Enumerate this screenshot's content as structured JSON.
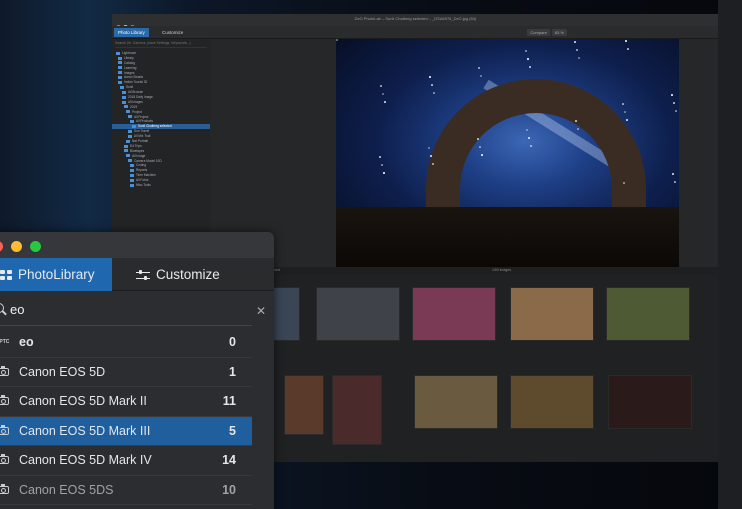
{
  "colors": {
    "accent": "#1f68b0",
    "selected_row": "#1f5f9e",
    "panel_bg": "#2c2d30",
    "traffic_close": "#ff5f57",
    "traffic_min": "#febc2e",
    "traffic_max": "#28c840"
  },
  "background_window": {
    "title": "DxO PhotoLab – Sunil Chalberg selected – _DSA6976_DxO.jpg (84)",
    "tabs": [
      {
        "label": "Photo Library",
        "active": true
      },
      {
        "label": "Customize",
        "active": false
      }
    ],
    "toolbar": {
      "compare": "Compare",
      "zoom": "83 %"
    },
    "sidebar_search_placeholder": "Search (ie: Camera, place Settings, Keywords...)",
    "sidebar_header": "Index a folder",
    "tree_items": [
      "Lightroom",
      "Library",
      "Catalog",
      "Learning",
      "Images",
      "Aaron Swartz",
      "Indian Tourist 30",
      "Sunil",
      "All Browse",
      "2018 Daily Image",
      "All Images",
      "2019",
      "Project",
      "All Project",
      "All Products",
      "Sunil Chalberg selected",
      "Sun Travel",
      "All Mix Trail",
      "Nat Portrait",
      "Ed Trips",
      "Bluetapes",
      "All Image",
      "Camera Model 10D",
      "Coding",
      "Reports",
      "Time Machine",
      "All Fotos",
      "Misc Tools"
    ],
    "selected_tree_item": "Sunil Chalberg selected",
    "strip_left": "0 selected",
    "strip_center": "1/50 images"
  },
  "panel": {
    "tabs": [
      {
        "label": "PhotoLibrary",
        "icon": "grid-icon",
        "active": true
      },
      {
        "label": "Customize",
        "icon": "sliders-icon",
        "active": false
      }
    ],
    "search": {
      "value": "eo",
      "placeholder": "Search"
    },
    "results": [
      {
        "label": "eo",
        "count": "0",
        "icon": "iptc-icon",
        "iptc_text": "IPTC",
        "selected": false
      },
      {
        "label": "Canon EOS 5D",
        "count": "1",
        "icon": "camera-icon",
        "selected": false
      },
      {
        "label": "Canon EOS 5D Mark II",
        "count": "11",
        "icon": "camera-icon",
        "selected": false
      },
      {
        "label": "Canon EOS 5D Mark III",
        "count": "5",
        "icon": "camera-icon",
        "selected": true
      },
      {
        "label": "Canon EOS 5D Mark IV",
        "count": "14",
        "icon": "camera-icon",
        "selected": false
      },
      {
        "label": "Canon EOS 5DS",
        "count": "10",
        "icon": "camera-icon",
        "selected": false
      }
    ]
  }
}
